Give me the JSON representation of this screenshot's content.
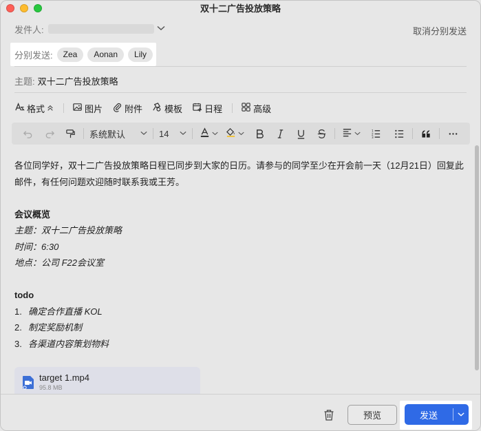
{
  "window": {
    "title": "双十二广告投放策略"
  },
  "header": {
    "from_label": "发件人:",
    "cancel_bcc_label": "取消分别发送",
    "bcc_label": "分别发送:",
    "bcc_recipients": [
      "Zea",
      "Aonan",
      "Lily"
    ],
    "subject_label": "主题:",
    "subject_value": "双十二广告投放策略"
  },
  "toolbar": {
    "format": "格式",
    "image": "图片",
    "attachment": "附件",
    "template": "模板",
    "schedule": "日程",
    "advanced": "高级"
  },
  "format_bar": {
    "font_family": "系统默认",
    "font_size": "14"
  },
  "body": {
    "intro": "各位同学好，双十二广告投放策略日程已同步到大家的日历。请参与的同学至少在开会前一天（12月21日）回复此邮件，有任何问题欢迎随时联系我或王芳。",
    "overview_title": "会议概览",
    "overview_subject": "主题：双十二广告投放策略",
    "overview_time": "时间：6:30",
    "overview_place": "地点：公司 F22会议室",
    "todo_title": "todo",
    "todo_items": [
      {
        "num": "1.",
        "text": "确定合作直播 KOL"
      },
      {
        "num": "2.",
        "text": "制定奖励机制"
      },
      {
        "num": "3.",
        "text": "各渠道内容策划物料"
      }
    ]
  },
  "attachment": {
    "name": "target 1.mp4",
    "size": "95.8 MB"
  },
  "footer": {
    "preview_label": "预览",
    "send_label": "发送"
  },
  "colors": {
    "accent": "#2f6ae6",
    "attachment_bg": "#dedfe8"
  }
}
